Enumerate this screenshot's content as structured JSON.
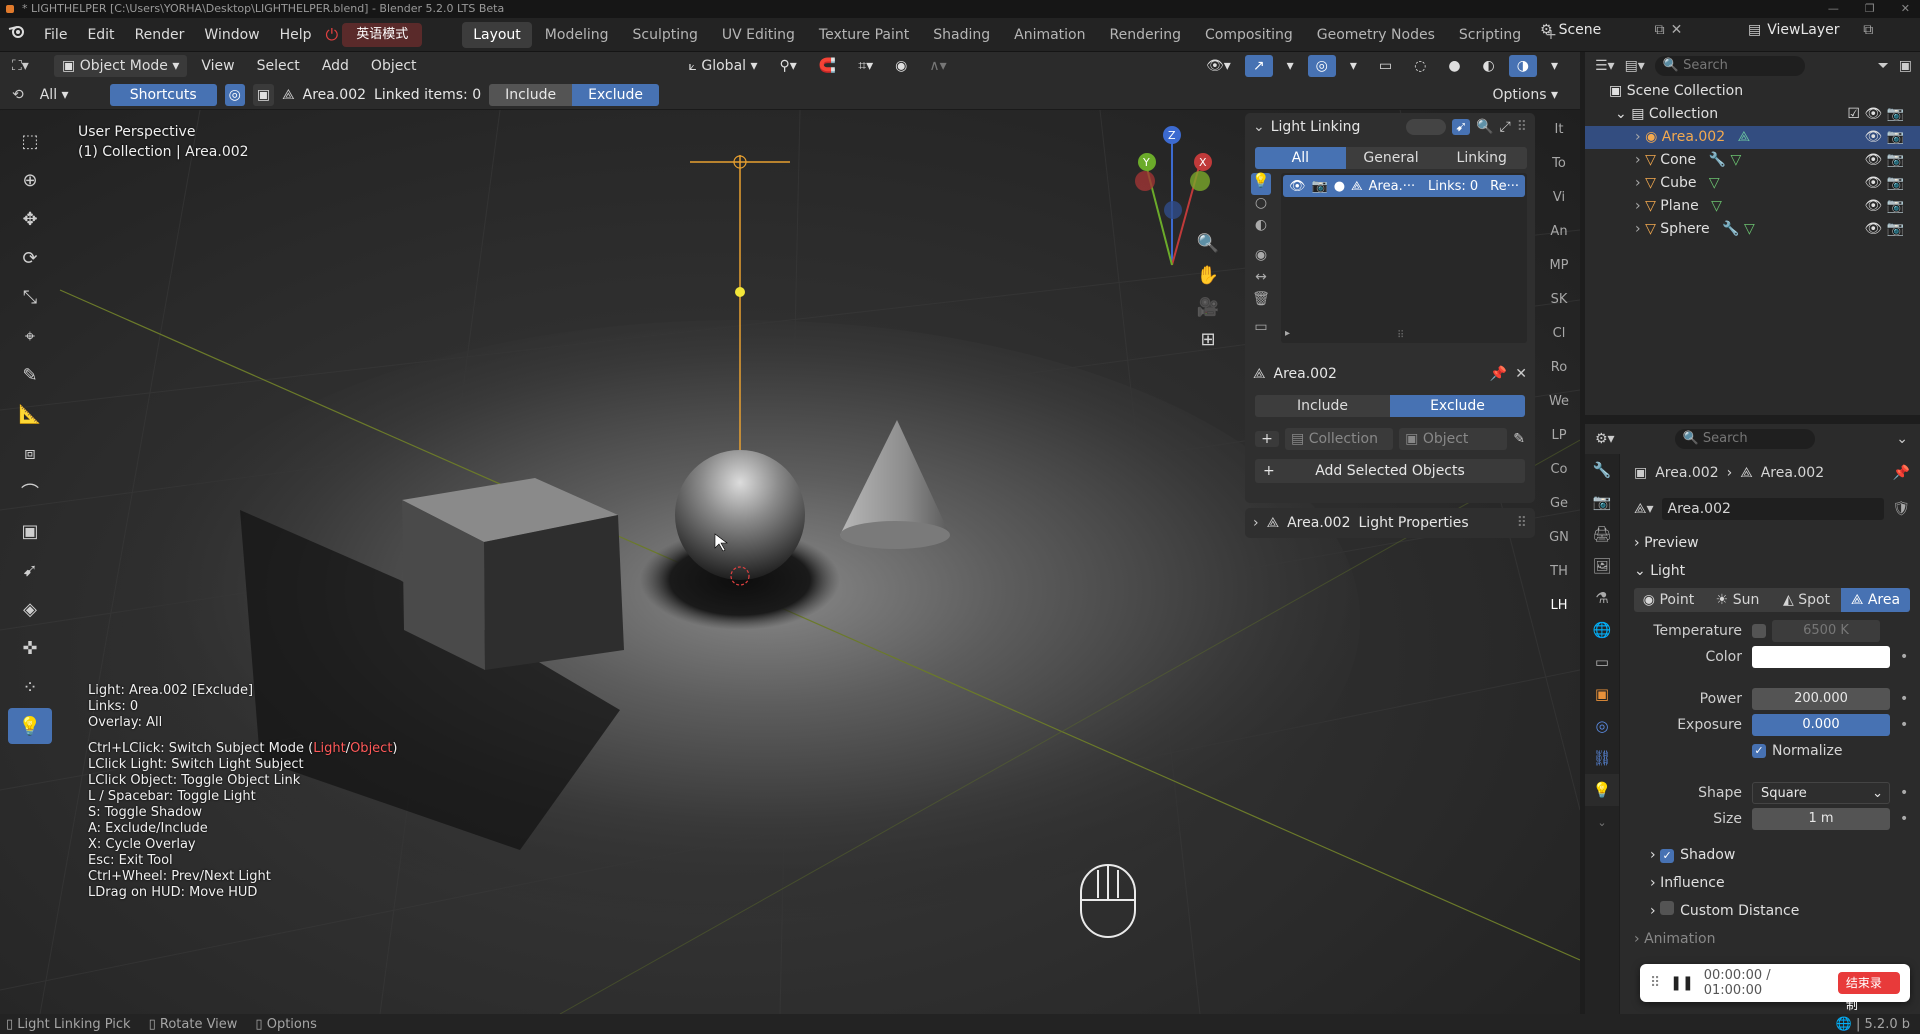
{
  "titlebar": {
    "title": "* LIGHTHELPER [C:\\Users\\YORHA\\Desktop\\LIGHTHELPER.blend] - Blender 5.2.0 LTS Beta"
  },
  "menubar": {
    "menus": [
      "File",
      "Edit",
      "Render",
      "Window",
      "Help"
    ],
    "ime_badge": "英语模式",
    "workspaces": [
      "Layout",
      "Modeling",
      "Sculpting",
      "UV Editing",
      "Texture Paint",
      "Shading",
      "Animation",
      "Rendering",
      "Compositing",
      "Geometry Nodes",
      "Scripting"
    ],
    "active_workspace": "Layout",
    "scene": "Scene",
    "view_layer": "ViewLayer"
  },
  "viewport_header": {
    "mode": "Object Mode",
    "menus": [
      "View",
      "Select",
      "Add",
      "Object"
    ],
    "transform": "Global",
    "options": "Options"
  },
  "tool_header": {
    "all_label": "All",
    "shortcuts": "Shortcuts",
    "light_name": "Area.002",
    "linked_items": "Linked items: 0",
    "include": "Include",
    "exclude": "Exclude"
  },
  "viewport": {
    "perspective": "User Perspective",
    "collection": "(1) Collection | Area.002",
    "hud_lines": [
      "Light: Area.002  [Exclude]",
      "Links: 0",
      "Overlay: All"
    ],
    "help_prefix": "Ctrl+LClick: Switch Subject Mode (",
    "help_light": "Light",
    "help_sep": "/",
    "help_object": "Object",
    "help_suffix": ")",
    "help_lines": [
      "LClick Light: Switch Light Subject",
      "LClick Object: Toggle Object Link",
      "L / Spacebar: Toggle Light",
      "S: Toggle Shadow",
      "A: Exclude/Include",
      "X: Cycle Overlay",
      "Esc: Exit Tool",
      "Ctrl+Wheel: Prev/Next Light",
      "LDrag on HUD: Move HUD"
    ],
    "accent_red": "#ff5a5a"
  },
  "light_linking": {
    "title": "Light Linking",
    "tabs": [
      "All",
      "General",
      "Linking"
    ],
    "active_tab": "All",
    "row_name": "Area.···",
    "row_links": "Links: 0",
    "row_re": "Re···",
    "target": "Area.002",
    "include": "Include",
    "exclude": "Exclude",
    "collection": "Collection",
    "object": "Object",
    "add_selected": "Add Selected Objects",
    "sub_name": "Area.002",
    "sub_label": "Light Properties"
  },
  "side_tabs": [
    "It",
    "To",
    "Vi",
    "An",
    "MP",
    "SK",
    "Cl",
    "Ro",
    "We",
    "LP",
    "Co",
    "Ge",
    "GN",
    "TH",
    "LH"
  ],
  "outliner": {
    "search_placeholder": "Search",
    "scene_collection": "Scene Collection",
    "collection": "Collection",
    "items": [
      "Area.002",
      "Cone",
      "Cube",
      "Plane",
      "Sphere"
    ]
  },
  "properties": {
    "search_placeholder": "Search",
    "breadcrumb_a": "Area.002",
    "breadcrumb_b": "Area.002",
    "datablock": "Area.002",
    "preview": "Preview",
    "light": "Light",
    "light_types": [
      "Point",
      "Sun",
      "Spot",
      "Area"
    ],
    "active_type": "Area",
    "temperature_label": "Temperature",
    "temperature_value": "6500 K",
    "color_label": "Color",
    "power_label": "Power",
    "power_value": "200.000",
    "exposure_label": "Exposure",
    "exposure_value": "0.000",
    "normalize": "Normalize",
    "shape_label": "Shape",
    "shape_value": "Square",
    "size_label": "Size",
    "size_value": "1 m",
    "shadow": "Shadow",
    "influence": "Influence",
    "custom_distance": "Custom Distance",
    "animation": "Animation"
  },
  "statusbar": {
    "items": [
      "Light Linking Pick",
      "Rotate View",
      "Options"
    ],
    "version": "5.2.0 b"
  },
  "recorder": {
    "time": "00:00:00 / 01:00:00",
    "stop": "结束录制"
  }
}
